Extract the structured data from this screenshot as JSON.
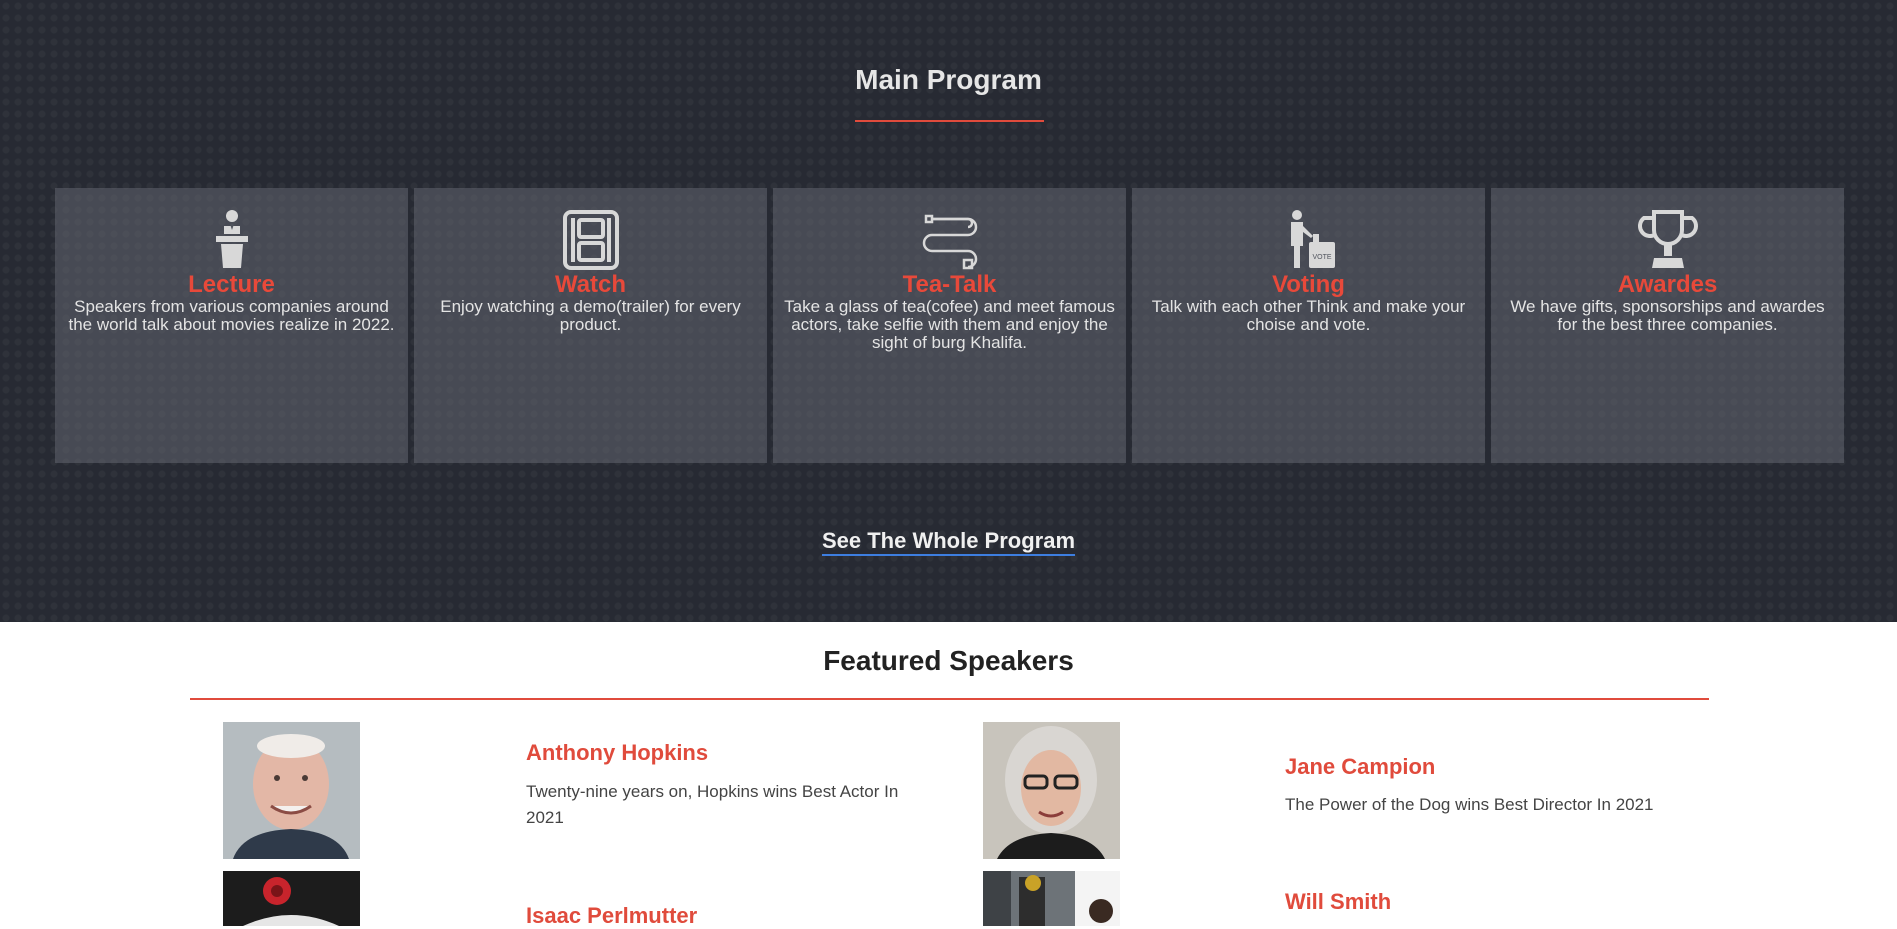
{
  "program": {
    "title": "Main Program",
    "cards": [
      {
        "title": "Lecture",
        "desc": "Speakers from various companies around the world talk about movies realize in 2022.",
        "icon": "lectern-icon"
      },
      {
        "title": "Watch",
        "desc": "Enjoy watching a demo(trailer) for every product.",
        "icon": "film-icon"
      },
      {
        "title": "Tea-Talk",
        "desc": "Take a glass of tea(cofee) and meet famous actors, take selfie with them and enjoy the sight of burg Khalifa.",
        "icon": "tea-cable-icon"
      },
      {
        "title": "Voting",
        "desc": "Talk with each other Think and make your choise and vote.",
        "icon": "voting-icon"
      },
      {
        "title": "Awardes",
        "desc": "We have gifts, sponsorships and awardes for the best three companies.",
        "icon": "trophy-icon"
      }
    ],
    "see_all_label": "See The Whole Program"
  },
  "speakers": {
    "title": "Featured Speakers",
    "items": [
      {
        "name": "Anthony Hopkins",
        "desc": "Twenty-nine years on, Hopkins wins Best Actor In 2021"
      },
      {
        "name": "Jane Campion",
        "desc": "The Power of the Dog wins Best Director In 2021"
      },
      {
        "name": "Isaac Perlmutter",
        "desc": ""
      },
      {
        "name": "Will Smith",
        "desc": ""
      }
    ],
    "vote_badge": "VOTE"
  },
  "colors": {
    "accent": "#e8493a",
    "dark_bg": "#272a33",
    "card_bg": "#4f535c",
    "link_underline": "#3d7ee0"
  }
}
